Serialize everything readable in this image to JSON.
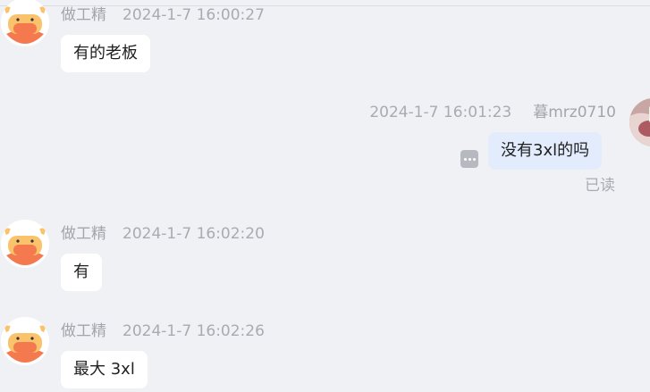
{
  "messages": [
    {
      "sender": "做工精",
      "time": "2024-1-7 16:00:27",
      "text": "有的老板"
    },
    {
      "sender": "暮mrz0710",
      "time": "2024-1-7 16:01:23",
      "text": "没有3xl的吗",
      "status": "已读"
    },
    {
      "sender": "做工精",
      "time": "2024-1-7 16:02:20",
      "text": "有"
    },
    {
      "sender": "做工精",
      "time": "2024-1-7 16:02:26",
      "text": "最大 3xl"
    }
  ],
  "icons": {
    "contact_avatar": "cow-avatar-icon",
    "more_actions": "more-dots-icon"
  },
  "colors": {
    "background": "#f0f1f5",
    "incoming_bubble": "#ffffff",
    "outgoing_bubble": "#e3ecfd",
    "meta_text": "#a8abb2",
    "avatar_orange": "#f5794e",
    "avatar_yellow": "#f9c26b"
  }
}
